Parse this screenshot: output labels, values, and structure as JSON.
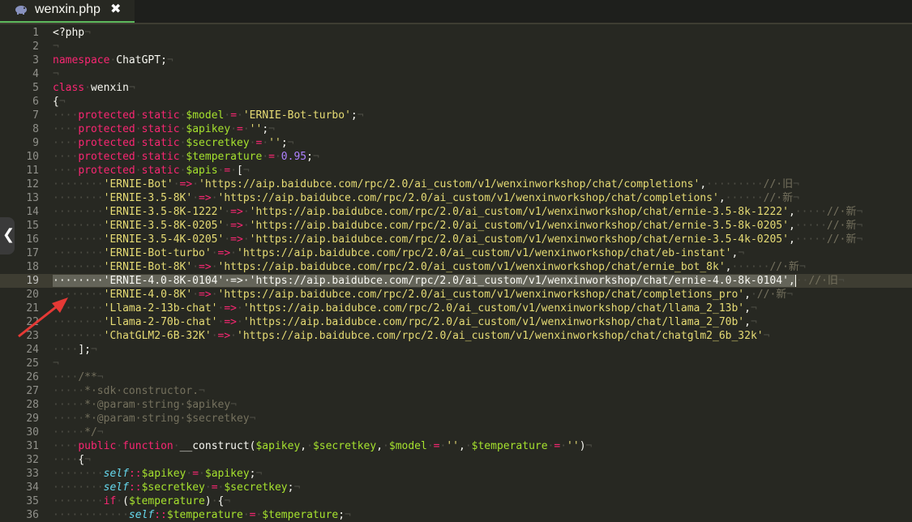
{
  "tab": {
    "title": "wenxin.php",
    "close_glyph": "✖",
    "icon": "elephant-icon"
  },
  "colors": {
    "background": "#272822",
    "keyword": "#f92672",
    "string": "#e6db74",
    "variable": "#a6e22e",
    "number": "#ae81ff",
    "comment": "#75715e",
    "arrow": "#e53935"
  },
  "active_line": 19,
  "line_numbers": [
    "1",
    "2",
    "3",
    "4",
    "5",
    "6",
    "7",
    "8",
    "9",
    "10",
    "11",
    "12",
    "13",
    "14",
    "15",
    "16",
    "17",
    "18",
    "19",
    "20",
    "21",
    "22",
    "23",
    "24",
    "25",
    "26",
    "27",
    "28",
    "29",
    "30",
    "31",
    "32",
    "33",
    "34",
    "35",
    "36"
  ],
  "lines": [
    [
      [
        "x",
        "<?php"
      ],
      [
        "i",
        "¬"
      ]
    ],
    [
      [
        "i",
        "¬"
      ]
    ],
    [
      [
        "k",
        "namespace"
      ],
      [
        "i",
        "·"
      ],
      [
        "x",
        "ChatGPT;"
      ],
      [
        "i",
        "¬"
      ]
    ],
    [
      [
        "i",
        "¬"
      ]
    ],
    [
      [
        "k",
        "class"
      ],
      [
        "i",
        "·"
      ],
      [
        "x",
        "wenxin"
      ],
      [
        "i",
        "¬"
      ]
    ],
    [
      [
        "x",
        "{"
      ],
      [
        "i",
        "¬"
      ]
    ],
    [
      [
        "i",
        "····"
      ],
      [
        "k",
        "protected"
      ],
      [
        "i",
        "·"
      ],
      [
        "k",
        "static"
      ],
      [
        "i",
        "·"
      ],
      [
        "v",
        "$model"
      ],
      [
        "i",
        "·"
      ],
      [
        "o",
        "="
      ],
      [
        "i",
        "·"
      ],
      [
        "s",
        "'ERNIE-Bot-turbo'"
      ],
      [
        "x",
        ";"
      ],
      [
        "i",
        "¬"
      ]
    ],
    [
      [
        "i",
        "····"
      ],
      [
        "k",
        "protected"
      ],
      [
        "i",
        "·"
      ],
      [
        "k",
        "static"
      ],
      [
        "i",
        "·"
      ],
      [
        "v",
        "$apikey"
      ],
      [
        "i",
        "·"
      ],
      [
        "o",
        "="
      ],
      [
        "i",
        "·"
      ],
      [
        "s",
        "''"
      ],
      [
        "x",
        ";"
      ],
      [
        "i",
        "¬"
      ]
    ],
    [
      [
        "i",
        "····"
      ],
      [
        "k",
        "protected"
      ],
      [
        "i",
        "·"
      ],
      [
        "k",
        "static"
      ],
      [
        "i",
        "·"
      ],
      [
        "v",
        "$secretkey"
      ],
      [
        "i",
        "·"
      ],
      [
        "o",
        "="
      ],
      [
        "i",
        "·"
      ],
      [
        "s",
        "''"
      ],
      [
        "x",
        ";"
      ],
      [
        "i",
        "¬"
      ]
    ],
    [
      [
        "i",
        "····"
      ],
      [
        "k",
        "protected"
      ],
      [
        "i",
        "·"
      ],
      [
        "k",
        "static"
      ],
      [
        "i",
        "·"
      ],
      [
        "v",
        "$temperature"
      ],
      [
        "i",
        "·"
      ],
      [
        "o",
        "="
      ],
      [
        "i",
        "·"
      ],
      [
        "n",
        "0.95"
      ],
      [
        "x",
        ";"
      ],
      [
        "i",
        "¬"
      ]
    ],
    [
      [
        "i",
        "····"
      ],
      [
        "k",
        "protected"
      ],
      [
        "i",
        "·"
      ],
      [
        "k",
        "static"
      ],
      [
        "i",
        "·"
      ],
      [
        "v",
        "$apis"
      ],
      [
        "i",
        "·"
      ],
      [
        "o",
        "="
      ],
      [
        "i",
        "·"
      ],
      [
        "x",
        "["
      ],
      [
        "i",
        "¬"
      ]
    ],
    [
      [
        "i",
        "········"
      ],
      [
        "s",
        "'ERNIE-Bot'"
      ],
      [
        "i",
        "·"
      ],
      [
        "o",
        "=>"
      ],
      [
        "i",
        "·"
      ],
      [
        "s",
        "'https://aip.baidubce.com/rpc/2.0/ai_custom/v1/wenxinworkshop/chat/completions'"
      ],
      [
        "x",
        ","
      ],
      [
        "i",
        "·········"
      ],
      [
        "c",
        "//·旧"
      ],
      [
        "i",
        "¬"
      ]
    ],
    [
      [
        "i",
        "········"
      ],
      [
        "s",
        "'ERNIE-3.5-8K'"
      ],
      [
        "i",
        "·"
      ],
      [
        "o",
        "=>"
      ],
      [
        "i",
        "·"
      ],
      [
        "s",
        "'https://aip.baidubce.com/rpc/2.0/ai_custom/v1/wenxinworkshop/chat/completions'"
      ],
      [
        "x",
        ","
      ],
      [
        "i",
        "······"
      ],
      [
        "c",
        "//·新"
      ],
      [
        "i",
        "¬"
      ]
    ],
    [
      [
        "i",
        "········"
      ],
      [
        "s",
        "'ERNIE-3.5-8K-1222'"
      ],
      [
        "i",
        "·"
      ],
      [
        "o",
        "=>"
      ],
      [
        "i",
        "·"
      ],
      [
        "s",
        "'https://aip.baidubce.com/rpc/2.0/ai_custom/v1/wenxinworkshop/chat/ernie-3.5-8k-1222'"
      ],
      [
        "x",
        ","
      ],
      [
        "i",
        "·····"
      ],
      [
        "c",
        "//·新"
      ],
      [
        "i",
        "¬"
      ]
    ],
    [
      [
        "i",
        "········"
      ],
      [
        "s",
        "'ERNIE-3.5-8K-0205'"
      ],
      [
        "i",
        "·"
      ],
      [
        "o",
        "=>"
      ],
      [
        "i",
        "·"
      ],
      [
        "s",
        "'https://aip.baidubce.com/rpc/2.0/ai_custom/v1/wenxinworkshop/chat/ernie-3.5-8k-0205'"
      ],
      [
        "x",
        ","
      ],
      [
        "i",
        "·····"
      ],
      [
        "c",
        "//·新"
      ],
      [
        "i",
        "¬"
      ]
    ],
    [
      [
        "i",
        "········"
      ],
      [
        "s",
        "'ERNIE-3.5-4K-0205'"
      ],
      [
        "i",
        "·"
      ],
      [
        "o",
        "=>"
      ],
      [
        "i",
        "·"
      ],
      [
        "s",
        "'https://aip.baidubce.com/rpc/2.0/ai_custom/v1/wenxinworkshop/chat/ernie-3.5-4k-0205'"
      ],
      [
        "x",
        ","
      ],
      [
        "i",
        "·····"
      ],
      [
        "c",
        "//·新"
      ],
      [
        "i",
        "¬"
      ]
    ],
    [
      [
        "i",
        "········"
      ],
      [
        "s",
        "'ERNIE-Bot-turbo'"
      ],
      [
        "i",
        "·"
      ],
      [
        "o",
        "=>"
      ],
      [
        "i",
        "·"
      ],
      [
        "s",
        "'https://aip.baidubce.com/rpc/2.0/ai_custom/v1/wenxinworkshop/chat/eb-instant'"
      ],
      [
        "x",
        ","
      ],
      [
        "i",
        "¬"
      ]
    ],
    [
      [
        "i",
        "········"
      ],
      [
        "s",
        "'ERNIE-Bot-8K'"
      ],
      [
        "i",
        "·"
      ],
      [
        "o",
        "=>"
      ],
      [
        "i",
        "·"
      ],
      [
        "s",
        "'https://aip.baidubce.com/rpc/2.0/ai_custom/v1/wenxinworkshop/chat/ernie_bot_8k'"
      ],
      [
        "x",
        ","
      ],
      [
        "i",
        "······"
      ],
      [
        "c",
        "//·新"
      ],
      [
        "i",
        "¬"
      ]
    ],
    [
      [
        "S",
        "········'ERNIE-4.0-8K-0104'·=>·'https://aip.baidubce.com/rpc/2.0/ai_custom/v1/wenxinworkshop/chat/ernie-4.0-8k-0104',"
      ],
      [
        "C",
        ""
      ],
      [
        "i",
        "··"
      ],
      [
        "c",
        "//·旧"
      ],
      [
        "i",
        "¬"
      ]
    ],
    [
      [
        "i",
        "········"
      ],
      [
        "s",
        "'ERNIE-4.0-8K'"
      ],
      [
        "i",
        "·"
      ],
      [
        "o",
        "=>"
      ],
      [
        "i",
        "·"
      ],
      [
        "s",
        "'https://aip.baidubce.com/rpc/2.0/ai_custom/v1/wenxinworkshop/chat/completions_pro'"
      ],
      [
        "x",
        ","
      ],
      [
        "i",
        "·"
      ],
      [
        "c",
        "//·新"
      ],
      [
        "i",
        "¬"
      ]
    ],
    [
      [
        "i",
        "········"
      ],
      [
        "s",
        "'Llama-2-13b-chat'"
      ],
      [
        "i",
        "·"
      ],
      [
        "o",
        "=>"
      ],
      [
        "i",
        "·"
      ],
      [
        "s",
        "'https://aip.baidubce.com/rpc/2.0/ai_custom/v1/wenxinworkshop/chat/llama_2_13b'"
      ],
      [
        "x",
        ","
      ],
      [
        "i",
        "¬"
      ]
    ],
    [
      [
        "i",
        "········"
      ],
      [
        "s",
        "'Llama-2-70b-chat'"
      ],
      [
        "i",
        "·"
      ],
      [
        "o",
        "=>"
      ],
      [
        "i",
        "·"
      ],
      [
        "s",
        "'https://aip.baidubce.com/rpc/2.0/ai_custom/v1/wenxinworkshop/chat/llama_2_70b'"
      ],
      [
        "x",
        ","
      ],
      [
        "i",
        "¬"
      ]
    ],
    [
      [
        "i",
        "········"
      ],
      [
        "s",
        "'ChatGLM2-6B-32K'"
      ],
      [
        "i",
        "·"
      ],
      [
        "o",
        "=>"
      ],
      [
        "i",
        "·"
      ],
      [
        "s",
        "'https://aip.baidubce.com/rpc/2.0/ai_custom/v1/wenxinworkshop/chat/chatglm2_6b_32k'"
      ],
      [
        "i",
        "¬"
      ]
    ],
    [
      [
        "i",
        "····"
      ],
      [
        "x",
        "];"
      ],
      [
        "i",
        "¬"
      ]
    ],
    [
      [
        "i",
        "¬"
      ]
    ],
    [
      [
        "i",
        "····"
      ],
      [
        "c",
        "/**"
      ],
      [
        "i",
        "¬"
      ]
    ],
    [
      [
        "i",
        "·····"
      ],
      [
        "c",
        "*·sdk·constructor."
      ],
      [
        "i",
        "¬"
      ]
    ],
    [
      [
        "i",
        "·····"
      ],
      [
        "c",
        "*·@param·string·$apikey"
      ],
      [
        "i",
        "¬"
      ]
    ],
    [
      [
        "i",
        "·····"
      ],
      [
        "c",
        "*·@param·string·$secretkey"
      ],
      [
        "i",
        "¬"
      ]
    ],
    [
      [
        "i",
        "·····"
      ],
      [
        "c",
        "*/"
      ],
      [
        "i",
        "¬"
      ]
    ],
    [
      [
        "i",
        "····"
      ],
      [
        "k",
        "public"
      ],
      [
        "i",
        "·"
      ],
      [
        "k",
        "function"
      ],
      [
        "i",
        "·"
      ],
      [
        "x",
        "__construct("
      ],
      [
        "v",
        "$apikey"
      ],
      [
        "x",
        ","
      ],
      [
        "i",
        "·"
      ],
      [
        "v",
        "$secretkey"
      ],
      [
        "x",
        ","
      ],
      [
        "i",
        "·"
      ],
      [
        "v",
        "$model"
      ],
      [
        "i",
        "·"
      ],
      [
        "o",
        "="
      ],
      [
        "i",
        "·"
      ],
      [
        "s",
        "''"
      ],
      [
        "x",
        ","
      ],
      [
        "i",
        "·"
      ],
      [
        "v",
        "$temperature"
      ],
      [
        "i",
        "·"
      ],
      [
        "o",
        "="
      ],
      [
        "i",
        "·"
      ],
      [
        "s",
        "''"
      ],
      [
        "x",
        ")"
      ],
      [
        "i",
        "¬"
      ]
    ],
    [
      [
        "i",
        "····"
      ],
      [
        "x",
        "{"
      ],
      [
        "i",
        "¬"
      ]
    ],
    [
      [
        "i",
        "········"
      ],
      [
        "f",
        "self"
      ],
      [
        "o",
        "::"
      ],
      [
        "v",
        "$apikey"
      ],
      [
        "i",
        "·"
      ],
      [
        "o",
        "="
      ],
      [
        "i",
        "·"
      ],
      [
        "v",
        "$apikey"
      ],
      [
        "x",
        ";"
      ],
      [
        "i",
        "¬"
      ]
    ],
    [
      [
        "i",
        "········"
      ],
      [
        "f",
        "self"
      ],
      [
        "o",
        "::"
      ],
      [
        "v",
        "$secretkey"
      ],
      [
        "i",
        "·"
      ],
      [
        "o",
        "="
      ],
      [
        "i",
        "·"
      ],
      [
        "v",
        "$secretkey"
      ],
      [
        "x",
        ";"
      ],
      [
        "i",
        "¬"
      ]
    ],
    [
      [
        "i",
        "········"
      ],
      [
        "k",
        "if"
      ],
      [
        "i",
        "·"
      ],
      [
        "x",
        "("
      ],
      [
        "v",
        "$temperature"
      ],
      [
        "x",
        ")"
      ],
      [
        "i",
        "·"
      ],
      [
        "x",
        "{"
      ],
      [
        "i",
        "¬"
      ]
    ],
    [
      [
        "i",
        "············"
      ],
      [
        "f",
        "self"
      ],
      [
        "o",
        "::"
      ],
      [
        "v",
        "$temperature"
      ],
      [
        "i",
        "·"
      ],
      [
        "o",
        "="
      ],
      [
        "i",
        "·"
      ],
      [
        "v",
        "$temperature"
      ],
      [
        "x",
        ";"
      ],
      [
        "i",
        "¬"
      ]
    ]
  ]
}
